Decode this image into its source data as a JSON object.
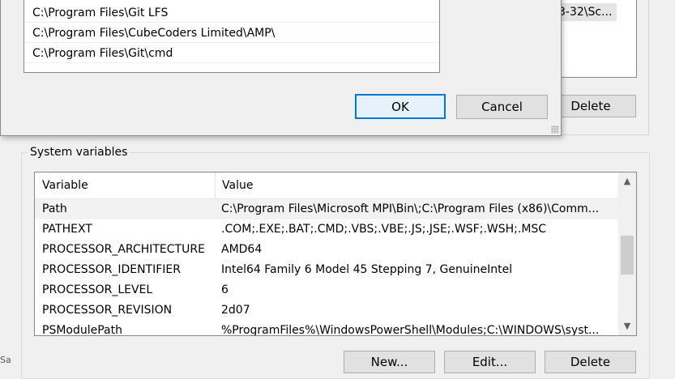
{
  "back_window": {
    "user_value_partial": "3-32\\Sc...",
    "delete_label": "Delete"
  },
  "edit_dialog": {
    "path_entries": [
      "C:\\Program Files\\Git LFS",
      "C:\\Program Files\\CubeCoders Limited\\AMP\\",
      "C:\\Program Files\\Git\\cmd"
    ],
    "ok_label": "OK",
    "cancel_label": "Cancel"
  },
  "system_variables": {
    "group_label": "System variables",
    "columns": [
      "Variable",
      "Value"
    ],
    "rows": [
      {
        "name": "Path",
        "value": "C:\\Program Files\\Microsoft MPI\\Bin\\;C:\\Program Files (x86)\\Comm...",
        "selected": true
      },
      {
        "name": "PATHEXT",
        "value": ".COM;.EXE;.BAT;.CMD;.VBS;.VBE;.JS;.JSE;.WSF;.WSH;.MSC"
      },
      {
        "name": "PROCESSOR_ARCHITECTURE",
        "value": "AMD64"
      },
      {
        "name": "PROCESSOR_IDENTIFIER",
        "value": "Intel64 Family 6 Model 45 Stepping 7, GenuineIntel"
      },
      {
        "name": "PROCESSOR_LEVEL",
        "value": "6"
      },
      {
        "name": "PROCESSOR_REVISION",
        "value": "2d07"
      },
      {
        "name": "PSModulePath",
        "value": "%ProgramFiles%\\WindowsPowerShell\\Modules;C:\\WINDOWS\\syst..."
      }
    ],
    "new_label": "New...",
    "edit_label": "Edit...",
    "delete_label": "Delete"
  },
  "left_edge_text": "Sa",
  "colors": {
    "accent": "#0078d7",
    "background": "#f0f0f0",
    "selection": "#f2f2f2"
  }
}
